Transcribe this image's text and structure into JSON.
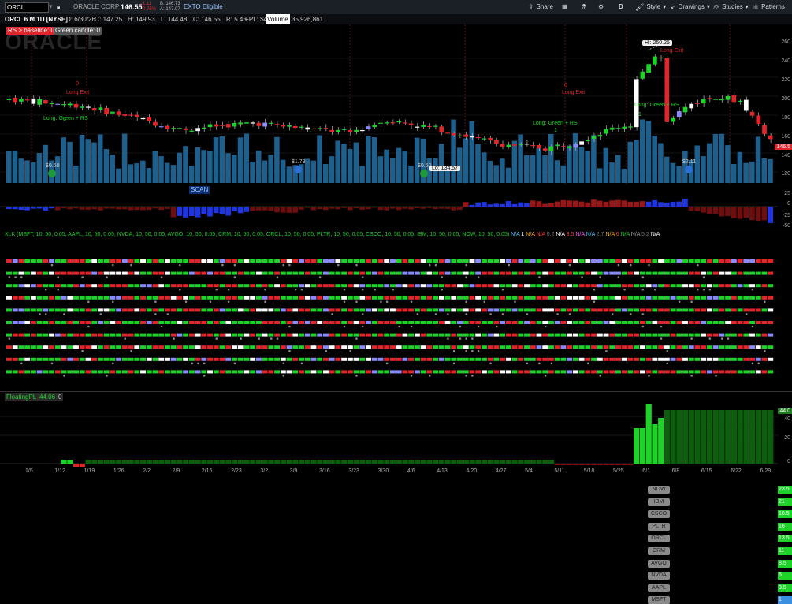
{
  "toolbar": {
    "symbol": "ORCL",
    "company": "ORACLE CORP",
    "last_price": "146.55",
    "change_top": "-1.11",
    "change_bottom": "-0.75%",
    "bid": "B: 146.73",
    "ask": "A: 147.07",
    "exto": "EXTO Eligible",
    "share_label": "Share",
    "interval_label": "D",
    "style_label": "Style",
    "drawings_label": "Drawings",
    "studies_label": "Studies",
    "patterns_label": "Patterns"
  },
  "infobar": {
    "title": "ORCL 6 M 1D [NYSE]",
    "date": "D: 6/30/26",
    "open": "O: 147.25",
    "high": "H: 149.93",
    "low": "L: 144.48",
    "close": "C: 146.55",
    "range": "R: 5.45",
    "fpl": "FPL: $44.06",
    "volume_label": "Volume",
    "volume_value": "35,926,861"
  },
  "price_panel": {
    "rs_label": "RS > baseline: 0",
    "green_label": "Green candle: 0",
    "watermark": "ORACLE",
    "last_tag": "146.5",
    "hi_label": "Hi: 250.25",
    "lo_label": "Lo: 134.57",
    "annotations": [
      {
        "text": "Long Exit"
      },
      {
        "text": "Long: Green + RS"
      },
      {
        "text": "Long Exit"
      },
      {
        "text": "Long: Green + RS"
      },
      {
        "text": "Long Exit"
      },
      {
        "text": "Long: Green + RS"
      }
    ],
    "digits": [
      "0",
      "1",
      "0",
      "1",
      "0",
      "1"
    ],
    "dividends": [
      "$0.50",
      "$1.79",
      "$0.50",
      "$2.11"
    ],
    "y_ticks": [
      "260",
      "240",
      "220",
      "200",
      "180",
      "160",
      "140",
      "120"
    ]
  },
  "osc_panel": {
    "label": "SCAN",
    "y_ticks": [
      "25",
      "0",
      "-25",
      "-50"
    ]
  },
  "xlk_panel": {
    "header": "XLK (MSFT, 10, 50, 0.05, AAPL, 10, 50, 0.05, NVDA, 10, 50, 0.05, AVGO, 10, 50, 0.05, CRM, 10, 50, 0.05, ORCL, 10, 50, 0.05, PLTR, 10, 50, 0.05, CSCO, 10, 50, 0.05, IBM, 10, 50, 0.05, NOW, 10, 50, 0.05)",
    "header_values": [
      "N/A",
      "1",
      "N/A",
      "N/A",
      "0.2",
      "N/A",
      "3.5",
      "N/A",
      "N/A",
      "2.7",
      "N/A",
      "6",
      "N/A",
      "N/A",
      "5.2",
      "N/A"
    ],
    "stocks": [
      "NOW",
      "IBM",
      "CSCO",
      "PLTR",
      "ORCL",
      "CRM",
      "AVGO",
      "NVDA",
      "AAPL",
      "MSFT"
    ],
    "values": [
      "23.5",
      "21",
      "18.5",
      "16",
      "13.5",
      "11",
      "8.5",
      "6",
      "3.5",
      "1"
    ]
  },
  "fpl_panel": {
    "label": "FloatingPL",
    "value": "44.06",
    "zero": "0",
    "last_tag": "44.0",
    "y_ticks": [
      "40",
      "20",
      "0"
    ]
  },
  "x_axis": {
    "labels": [
      "1/5",
      "1/12",
      "1/19",
      "1/26",
      "2/2",
      "2/9",
      "2/16",
      "2/23",
      "3/2",
      "3/9",
      "3/16",
      "3/23",
      "3/30",
      "4/6",
      "4/13",
      "4/20",
      "4/27",
      "5/4",
      "5/11",
      "5/18",
      "5/25",
      "6/1",
      "6/8",
      "6/15",
      "6/22",
      "6/29"
    ]
  },
  "colors": {
    "up": "#1fd22a",
    "down": "#e0262b",
    "volume": "#1e5f8c",
    "accent": "#3a8fe0"
  }
}
